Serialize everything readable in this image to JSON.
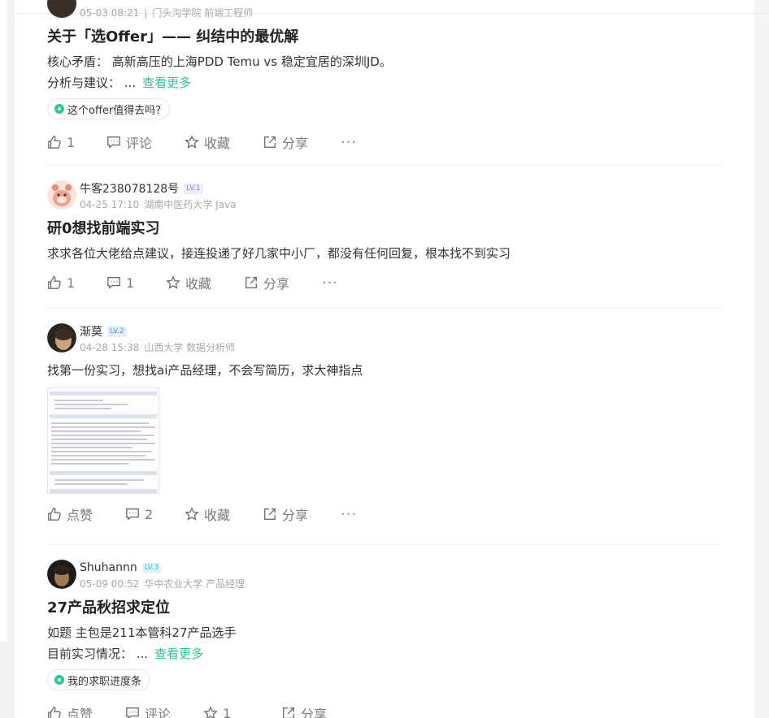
{
  "posts": [
    {
      "meta_date": "05-03 08:21",
      "meta_school": "门头沟学院 前端工程师",
      "title": "关于「选Offer」—— 纠结中的最优解",
      "body_lines": [
        "核心矛盾： 高新高压的上海PDD Temu vs 稳定宜居的深圳JD。",
        "分析与建议： ..."
      ],
      "more_label": "查看更多",
      "topic": "这个offer值得去吗?",
      "actions": {
        "like": "1",
        "comment": "评论",
        "star": "收藏",
        "share": "分享",
        "more": "···"
      }
    },
    {
      "name": "牛客238078128号",
      "level": "LV.1",
      "meta_date": "04-25 17:10",
      "meta_school": "湖南中医药大学 Java",
      "title": "研0想找前端实习",
      "body_lines": [
        "求求各位大佬给点建议，接连投递了好几家中小厂，都没有任何回复，根本找不到实习"
      ],
      "actions": {
        "like": "1",
        "comment": "1",
        "star": "收藏",
        "share": "分享",
        "more": "···"
      }
    },
    {
      "name": "渐莫",
      "level": "LV.2",
      "meta_date": "04-28 15:38",
      "meta_school": "山西大学 数据分析师",
      "body_lines": [
        "找第一份实习，想找ai产品经理，不会写简历，求大神指点"
      ],
      "actions": {
        "like": "点赞",
        "comment": "2",
        "star": "收藏",
        "share": "分享",
        "more": "···"
      }
    },
    {
      "name": "Shuhannn",
      "level": "LV.3",
      "meta_date": "05-09 00:52",
      "meta_school": "华中农业大学 产品经理",
      "title": "27产品秋招求定位",
      "body_lines": [
        "如题 主包是211本管科27产品选手",
        "目前实习情况： ..."
      ],
      "more_label": "查看更多",
      "topic": "我的求职进度条",
      "actions": {
        "like": "点赞",
        "comment": "评论",
        "star": "1",
        "share": "分享",
        "more": "···"
      }
    }
  ],
  "colors": {
    "accent": "#32c29b",
    "lv1_bg": "#efeafd",
    "lv1_fg": "#9b86e6",
    "lv2_bg": "#e4efff",
    "lv2_fg": "#4a8ef0",
    "lv3_bg": "#dff6f8",
    "lv3_fg": "#2cb7c9"
  },
  "icons": [
    "like-icon",
    "comment-icon",
    "star-icon",
    "share-icon",
    "more-icon",
    "topic-icon"
  ]
}
